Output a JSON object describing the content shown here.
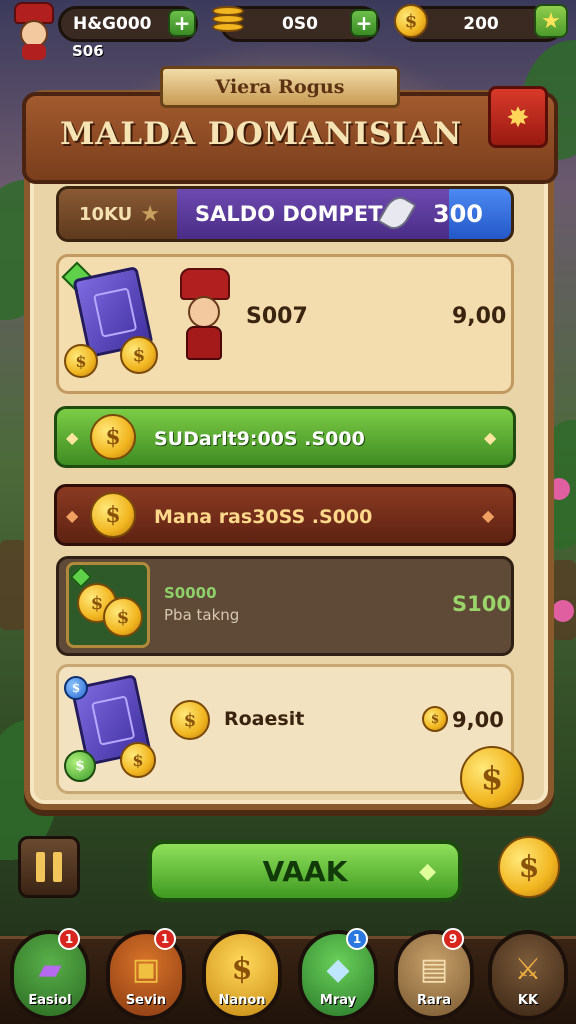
{
  "hud": {
    "player_value": "H&G000",
    "player_sub": "S06",
    "currency_1": "0S0",
    "currency_2": "200",
    "plus_symbol": "+",
    "star_symbol": "★"
  },
  "panel": {
    "ribbon": "Viera Rogus",
    "title": "MALDA DOMANISIAN"
  },
  "wallet": {
    "left_label": "10KU",
    "label": "SALDO DOMPET",
    "amount": "300"
  },
  "items": [
    {
      "value": "S007",
      "price": "9,00"
    },
    {
      "text": "SUDarlt9:00S .S000"
    },
    {
      "text": "Mana ras30SS .S000"
    },
    {
      "title": "S0000",
      "subtitle": "Pba takng",
      "price": "S100"
    },
    {
      "title": "Roaesit",
      "price": "9,00"
    }
  ],
  "actions": {
    "main_button": "VAAK"
  },
  "tabs": [
    {
      "label": "Easiol",
      "badge": "1",
      "color": "#7c3aa8"
    },
    {
      "label": "Sevin",
      "badge": "1",
      "color": "#c8741c"
    },
    {
      "label": "Nanon",
      "badge": "",
      "color": "#d89a1c"
    },
    {
      "label": "Mray",
      "badge": "1",
      "color": "#3a9a3a"
    },
    {
      "label": "Rara",
      "badge": "9",
      "color": "#b88a4a"
    },
    {
      "label": "KK",
      "badge": "",
      "color": "#5a3a22"
    }
  ],
  "colors": {
    "accent_green": "#4f9a2a",
    "wallet_purple": "#5a3a9a",
    "wallet_blue": "#2f66d6",
    "wood": "#7a3e1c",
    "parchment": "#e9d4a8"
  }
}
